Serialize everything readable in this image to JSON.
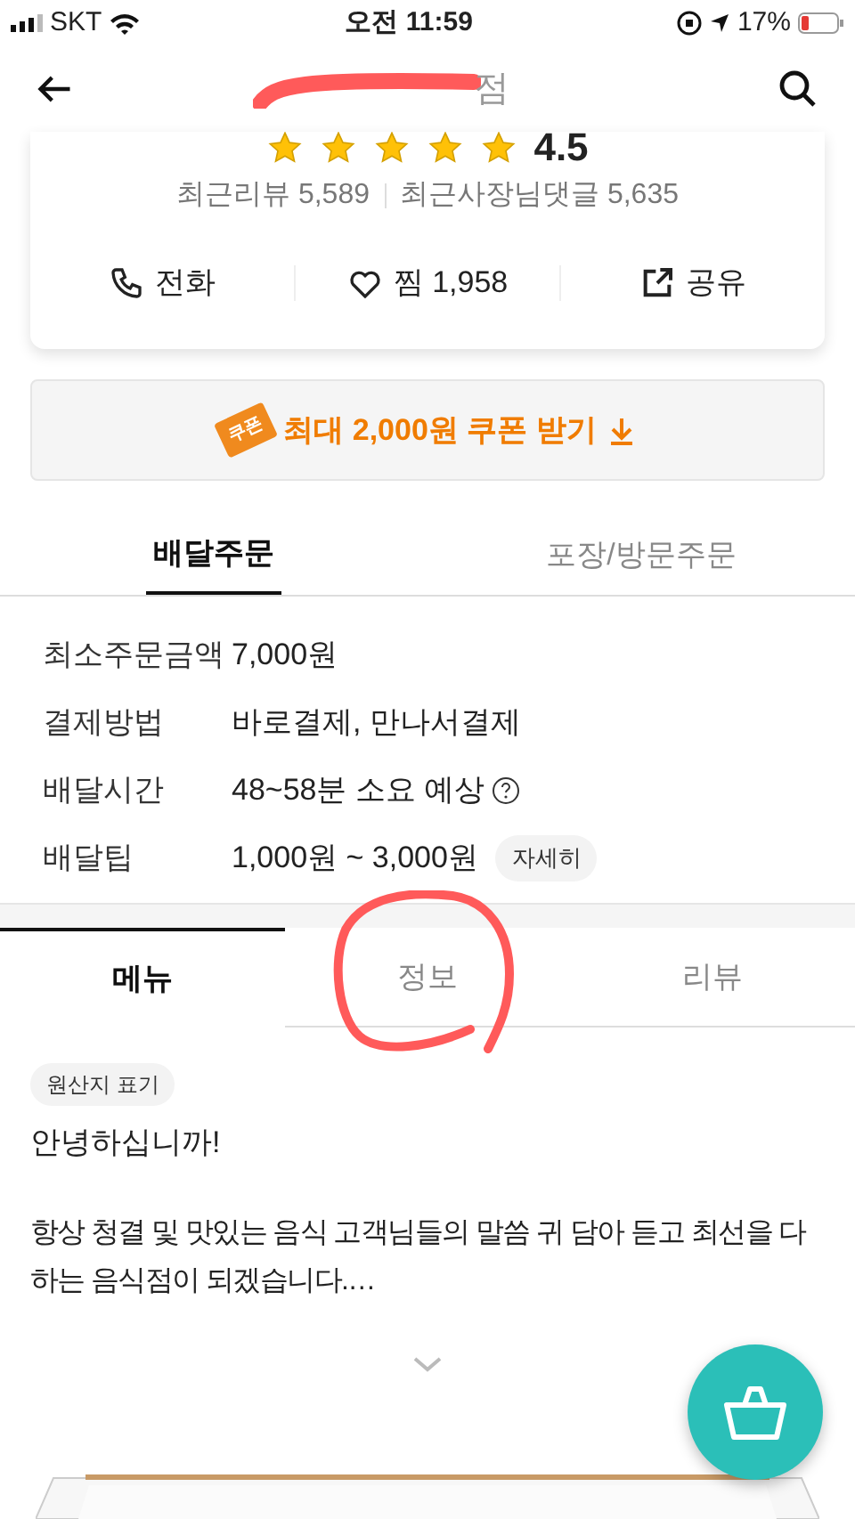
{
  "status_bar": {
    "carrier": "SKT",
    "time": "오전 11:59",
    "battery": "17%"
  },
  "header": {
    "title": "점"
  },
  "store_card": {
    "stars": 5,
    "rating": "4.5",
    "reviews": "최근리뷰 5,589",
    "owner_replies": "최근사장님댓글 5,635",
    "actions": [
      {
        "kind": "phone",
        "label": "전화"
      },
      {
        "kind": "heart",
        "label": "찜 1,958"
      },
      {
        "kind": "share",
        "label": "공유"
      }
    ]
  },
  "coupon": {
    "badge": "쿠폰",
    "label": "최대 2,000원 쿠폰 받기"
  },
  "order_tabs": [
    {
      "label": "배달주문",
      "selected": true
    },
    {
      "label": "포장/방문주문",
      "selected": false
    }
  ],
  "info_rows": [
    {
      "label": "최소주문금액",
      "value": "7,000원"
    },
    {
      "label": "결제방법",
      "value": "바로결제, 만나서결제"
    },
    {
      "label": "배달시간",
      "value": "48~58분 소요 예상",
      "help": true
    },
    {
      "label": "배달팁",
      "value": "1,000원 ~ 3,000원",
      "button": "자세히"
    }
  ],
  "content_tabs": [
    {
      "label": "메뉴",
      "selected": true
    },
    {
      "label": "정보",
      "selected": false
    },
    {
      "label": "리뷰",
      "selected": false
    }
  ],
  "notice": {
    "tag": "원산지 표기",
    "greeting": "안녕하십니까!",
    "body": "항상 청결 및 맛있는 음식 고객님들의 말씀 귀 담아 듣고 최선을 다하는 음식점이 되겠습니다.…"
  }
}
